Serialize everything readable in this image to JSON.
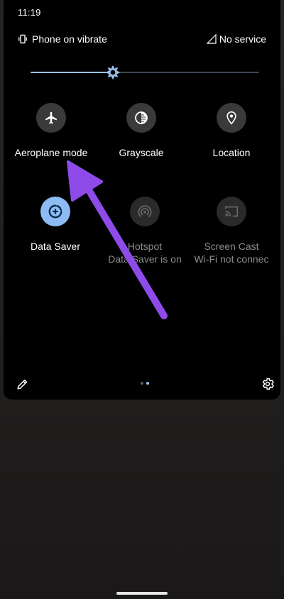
{
  "status_bar": {
    "time": "11:19"
  },
  "header": {
    "ringer_status": "Phone on vibrate",
    "network_status": "No service"
  },
  "brightness": {
    "level_percent": 36
  },
  "tiles": [
    {
      "label": "Aeroplane mode",
      "sublabel": "",
      "icon": "airplane-icon",
      "state": "off"
    },
    {
      "label": "Grayscale",
      "sublabel": "",
      "icon": "grayscale-icon",
      "state": "off"
    },
    {
      "label": "Location",
      "sublabel": "",
      "icon": "location-pin-icon",
      "state": "off"
    },
    {
      "label": "Data Saver",
      "sublabel": "",
      "icon": "data-saver-icon",
      "state": "on"
    },
    {
      "label": "Hotspot",
      "sublabel": "Data Saver is on",
      "icon": "hotspot-icon",
      "state": "disabled"
    },
    {
      "label": "Screen Cast",
      "sublabel": "Wi-Fi not connec",
      "icon": "cast-icon",
      "state": "disabled"
    }
  ],
  "pager": {
    "pages": 2,
    "current": 2
  },
  "colors": {
    "accent": "#8cbcf3",
    "annotation_arrow": "#8e4bea"
  }
}
